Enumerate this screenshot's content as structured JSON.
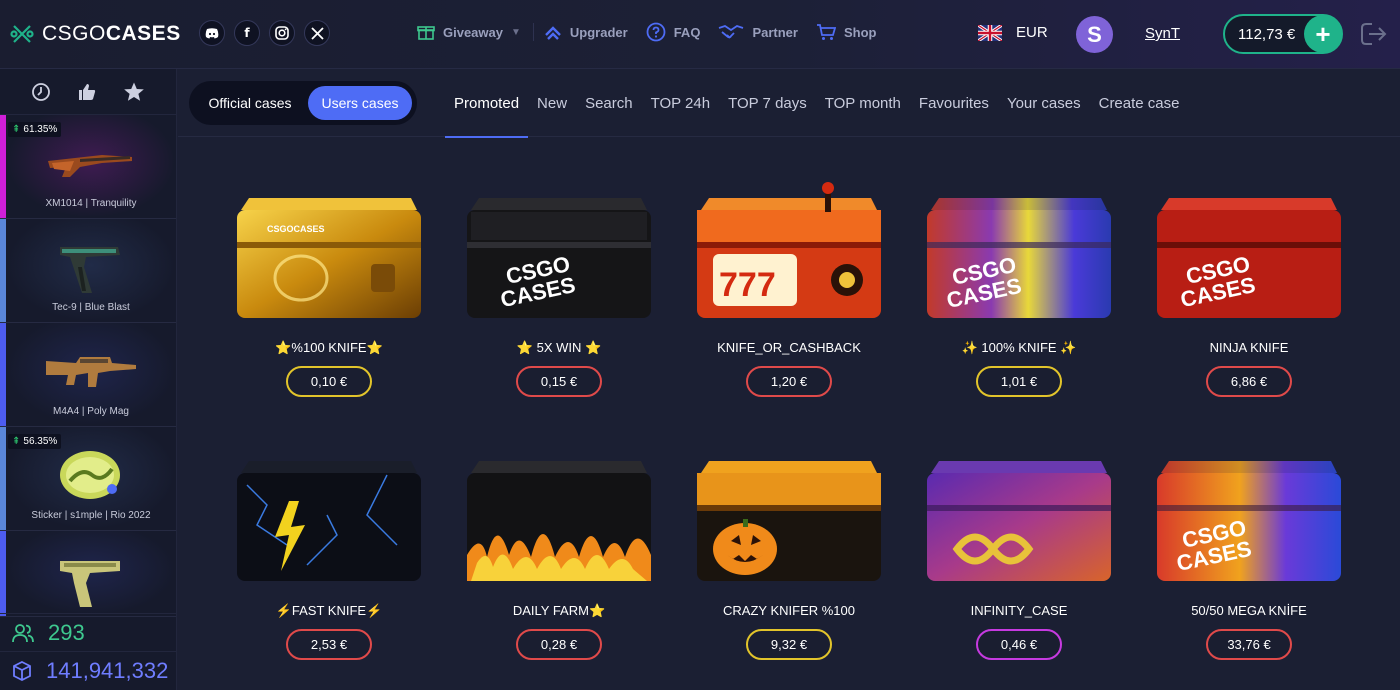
{
  "header": {
    "logo_light": "CSGO",
    "logo_bold": "CASES",
    "socials": [
      "discord-icon",
      "facebook-icon",
      "instagram-icon",
      "x-icon"
    ],
    "nav": [
      {
        "label": "Giveaway",
        "icon": "gift-icon"
      },
      {
        "label": "Upgrader",
        "icon": "upgrade-icon"
      },
      {
        "label": "FAQ",
        "icon": "question-icon"
      },
      {
        "label": "Partner",
        "icon": "handshake-icon"
      },
      {
        "label": "Shop",
        "icon": "cart-icon"
      }
    ],
    "currency": "EUR",
    "avatar_letter": "S",
    "username": "SynT",
    "balance": "112,73 €",
    "add_funds": "+"
  },
  "sidebar": {
    "tabs": [
      "history-icon",
      "thumbs-up-icon",
      "star-icon"
    ],
    "drops": [
      {
        "name": "XM1014 | Tranquility",
        "pct": "61.35%",
        "color": "#d01fd8"
      },
      {
        "name": "Tec-9 | Blue Blast",
        "pct": "",
        "color": "#5a86d8"
      },
      {
        "name": "M4A4 | Poly Mag",
        "pct": "",
        "color": "#4d5cf0"
      },
      {
        "name": "Sticker | s1mple | Rio 2022",
        "pct": "56.35%",
        "color": "#5a86d8"
      },
      {
        "name": "",
        "pct": "",
        "color": "#4d5cf0"
      }
    ],
    "online_count": "293",
    "opened_count": "141,941,332"
  },
  "subnav": {
    "toggle": [
      "Official cases",
      "Users cases"
    ],
    "tabs": [
      "Promoted",
      "New",
      "Search",
      "TOP 24h",
      "TOP 7 days",
      "TOP month",
      "Favourites",
      "Your cases",
      "Create case"
    ]
  },
  "cases": [
    {
      "title": "⭐%100 KNIFE⭐",
      "price": "0,10 €",
      "border": "#e2c42b",
      "theme": "gold"
    },
    {
      "title": "⭐ 5X WIN ⭐",
      "price": "0,15 €",
      "border": "#e04a4a",
      "theme": "black"
    },
    {
      "title": "KNIFE_OR_CASHBACK",
      "price": "1,20 €",
      "border": "#e04a4a",
      "theme": "slot"
    },
    {
      "title": "✨ 100% KNIFE ✨",
      "price": "1,01 €",
      "border": "#e2c42b",
      "theme": "rainbow"
    },
    {
      "title": "NINJA KNIFE",
      "price": "6,86 €",
      "border": "#e04a4a",
      "theme": "red"
    },
    {
      "title": "⚡FAST KNIFE⚡",
      "price": "2,53 €",
      "border": "#e04a4a",
      "theme": "lightning"
    },
    {
      "title": "DAILY FARM⭐",
      "price": "0,28 €",
      "border": "#e04a4a",
      "theme": "fire"
    },
    {
      "title": "CRAZY KNIFER %100",
      "price": "9,32 €",
      "border": "#e2c42b",
      "theme": "pumpkin"
    },
    {
      "title": "INFINITY_CASE",
      "price": "0,46 €",
      "border": "#c63ae0",
      "theme": "galaxy"
    },
    {
      "title": "50/50 MEGA KNİFE",
      "price": "33,76 €",
      "border": "#e04a4a",
      "theme": "rainbow2"
    }
  ]
}
